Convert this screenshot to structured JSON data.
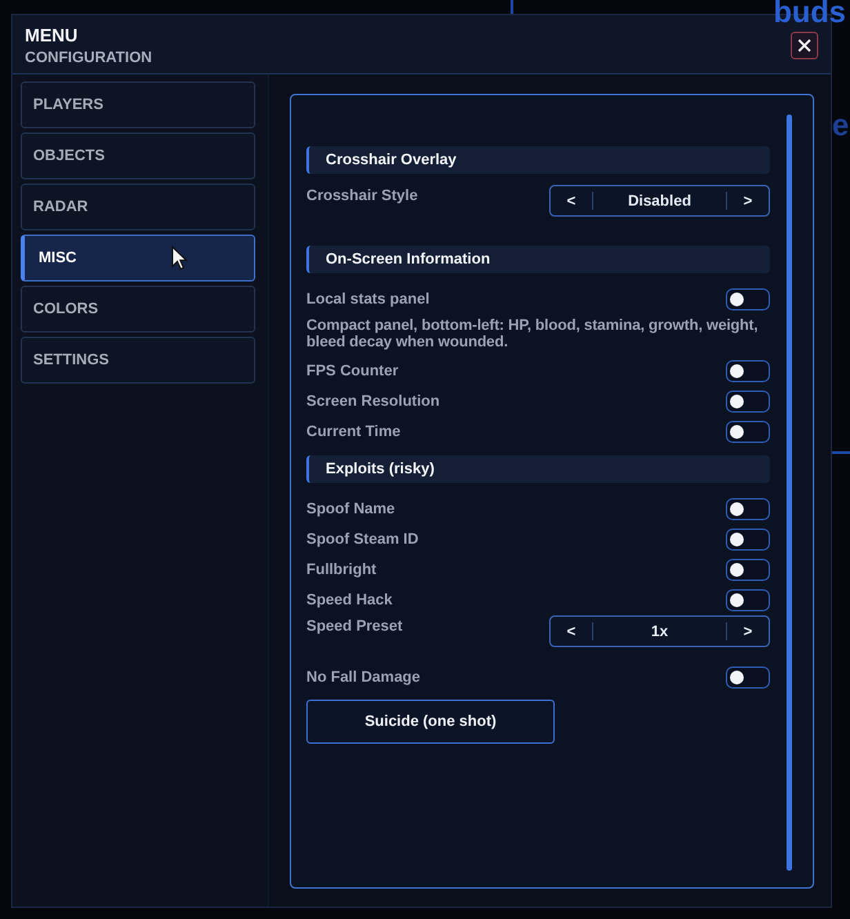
{
  "background": {
    "texts": [
      "buds",
      "e"
    ]
  },
  "window": {
    "title": "MENU",
    "subtitle": "CONFIGURATION"
  },
  "sidebar": {
    "items": [
      {
        "label": "PLAYERS",
        "selected": false
      },
      {
        "label": "OBJECTS",
        "selected": false
      },
      {
        "label": "RADAR",
        "selected": false
      },
      {
        "label": "MISC",
        "selected": true
      },
      {
        "label": "COLORS",
        "selected": false
      },
      {
        "label": "SETTINGS",
        "selected": false
      }
    ]
  },
  "sections": [
    {
      "title": "Crosshair Overlay",
      "rows": [
        {
          "kind": "stepper",
          "label": "Crosshair Style",
          "prev": "<",
          "value": "Disabled",
          "next": ">"
        }
      ]
    },
    {
      "title": "On-Screen Information",
      "rows": [
        {
          "kind": "toggle",
          "label": "Local stats panel",
          "on": false
        },
        {
          "kind": "note",
          "text": "Compact panel, bottom-left: HP, blood, stamina, growth, weight, bleed decay when wounded."
        },
        {
          "kind": "toggle",
          "label": "FPS Counter",
          "on": false
        },
        {
          "kind": "toggle",
          "label": "Screen Resolution",
          "on": false
        },
        {
          "kind": "toggle",
          "label": "Current Time",
          "on": false
        }
      ]
    },
    {
      "title": "Exploits (risky)",
      "rows": [
        {
          "kind": "toggle",
          "label": "Spoof Name",
          "on": false
        },
        {
          "kind": "toggle",
          "label": "Spoof Steam ID",
          "on": false
        },
        {
          "kind": "toggle",
          "label": "Fullbright",
          "on": false
        },
        {
          "kind": "toggle",
          "label": "Speed Hack",
          "on": false
        },
        {
          "kind": "stepper",
          "label": "Speed Preset",
          "prev": "<",
          "value": "1x",
          "next": ">"
        },
        {
          "kind": "toggle",
          "label": "No Fall Damage",
          "on": false
        },
        {
          "kind": "button",
          "label": "Suicide (one shot)"
        }
      ]
    }
  ]
}
